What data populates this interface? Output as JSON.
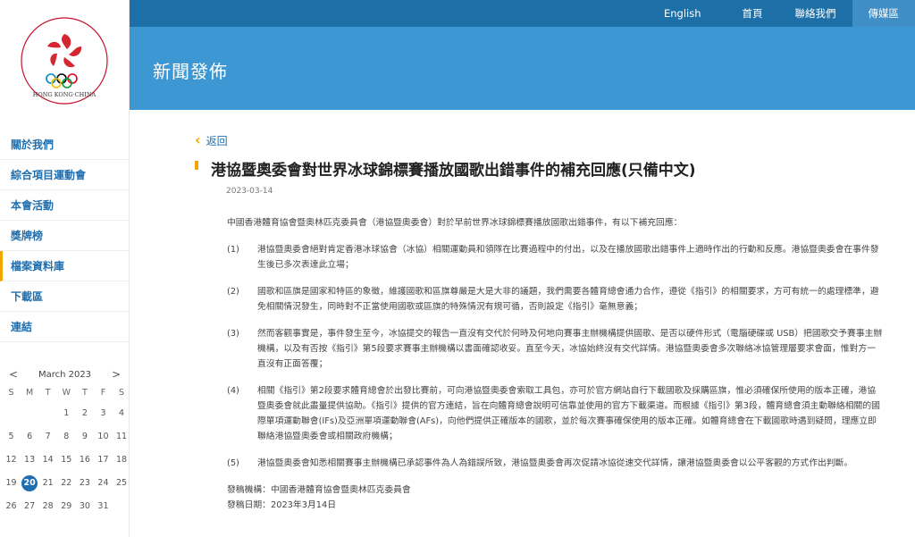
{
  "logo": {
    "caption": "HONG KONG·CHINA",
    "side_text": "中國香港體育協會暨奧林匹克委員會"
  },
  "topnav": {
    "english": "English",
    "home": "首頁",
    "contact": "聯絡我們",
    "traditional": "傳媒區"
  },
  "banner": {
    "title": "新聞發佈"
  },
  "sidebar": {
    "items": [
      {
        "label": "關於我們"
      },
      {
        "label": "綜合項目運動會"
      },
      {
        "label": "本會活動"
      },
      {
        "label": "獎牌榜"
      },
      {
        "label": "檔案資料庫"
      },
      {
        "label": "下載區"
      },
      {
        "label": "連結"
      }
    ]
  },
  "calendar": {
    "month": "March 2023",
    "prev": "<",
    "next": ">",
    "weekdays": [
      "S",
      "M",
      "T",
      "W",
      "T",
      "F",
      "S"
    ],
    "days": [
      "",
      "",
      "",
      "1",
      "2",
      "3",
      "4",
      "5",
      "6",
      "7",
      "8",
      "9",
      "10",
      "11",
      "12",
      "13",
      "14",
      "15",
      "16",
      "17",
      "18",
      "19",
      "20",
      "21",
      "22",
      "23",
      "24",
      "25",
      "26",
      "27",
      "28",
      "29",
      "30",
      "31"
    ],
    "today": "20"
  },
  "article": {
    "back": "返回",
    "title": "港協暨奧委會對世界冰球錦標賽播放國歌出錯事件的補充回應(只備中文)",
    "date": "2023-03-14",
    "intro": "中國香港體育協會暨奧林匹克委員會（港協暨奧委會）對於早前世界冰球錦標賽播放國歌出錯事件，有以下補充回應：",
    "paragraphs": [
      {
        "num": "(1)",
        "text": "港協暨奧委會絕對肯定香港冰球協會（冰協）相關運動員和領隊在比賽過程中的付出，以及在播放國歌出錯事件上適時作出的行動和反應。港協暨奧委會在事件發生後已多次表達此立場；"
      },
      {
        "num": "(2)",
        "text": "國歌和區旗是國家和特區的象徵，維護國歌和區旗尊嚴是大是大非的議題，我們需要各體育總會通力合作，遵從《指引》的相關要求，方可有統一的處理標準，避免相關情況發生，同時對不正當使用國歌或區旗的特殊情況有規可循，否則設定《指引》毫無意義；"
      },
      {
        "num": "(3)",
        "text": "然而客觀事實是，事件發生至今，冰協提交的報告一直沒有交代於何時及何地向賽事主辦機構提供國歌、是否以硬件形式（電腦硬碟或 USB）把國歌交予賽事主辦機構，以及有否按《指引》第5段要求賽事主辦機構以書面確認收妥。直至今天，冰協始終沒有交代詳情。港協暨奧委會多次聯絡冰協管理層要求會面，惟對方一直沒有正面答覆；"
      },
      {
        "num": "(4)",
        "text": "相關《指引》第2段要求體育總會於出發比賽前，可向港協暨奧委會索取工具包，亦可於官方網站自行下載國歌及採購區旗，惟必須確保所使用的版本正確，港協暨奧委會就此盡量提供協助。《指引》提供的官方連結，旨在向體育總會說明可信靠並使用的官方下載渠道。而根據《指引》第3段，體育總會須主動聯絡相關的國際單項運動聯會(IFs)及亞洲單項運動聯會(AFs)，向他們提供正確版本的國歌，並於每次賽事確保使用的版本正確。如體育總會在下載國歌時遇到疑問，理應立即聯絡港協暨奧委會或相關政府機構；"
      },
      {
        "num": "(5)",
        "text": "港協暨奧委會知悉相關賽事主辦機構已承認事件為人為錯誤所致，港協暨奧委會再次促請冰協從速交代詳情，讓港協暨奧委會以公平客觀的方式作出判斷。"
      }
    ],
    "issuer": "發稿機構：中國香港體育協會暨奧林匹克委員會",
    "issue_date": "發稿日期：2023年3月14日"
  }
}
